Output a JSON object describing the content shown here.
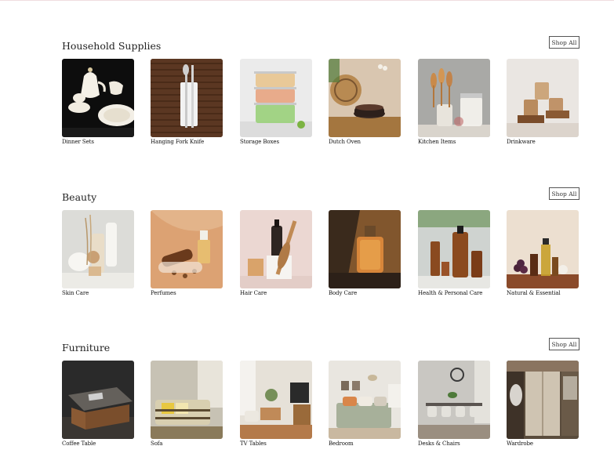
{
  "sections": [
    {
      "title": "Household Supplies",
      "shop_all": "Shop All",
      "items": [
        {
          "label": "Dinner Sets",
          "icon": "dinner-set-image"
        },
        {
          "label": "Hanging Fork Knife",
          "icon": "fork-knife-image"
        },
        {
          "label": "Storage Boxes",
          "icon": "storage-boxes-image"
        },
        {
          "label": "Dutch Oven",
          "icon": "dutch-oven-image"
        },
        {
          "label": "Kitchen Items",
          "icon": "kitchen-items-image"
        },
        {
          "label": "Drinkware",
          "icon": "drinkware-image"
        }
      ]
    },
    {
      "title": "Beauty",
      "shop_all": "Shop All",
      "items": [
        {
          "label": "Skin Care",
          "icon": "skin-care-image"
        },
        {
          "label": "Perfumes",
          "icon": "perfumes-image"
        },
        {
          "label": "Hair Care",
          "icon": "hair-care-image"
        },
        {
          "label": "Body Care",
          "icon": "body-care-image"
        },
        {
          "label": "Health & Personal Care",
          "icon": "health-personal-care-image"
        },
        {
          "label": "Natural & Essential",
          "icon": "natural-essential-image"
        }
      ]
    },
    {
      "title": "Furniture",
      "shop_all": "Shop All",
      "items": [
        {
          "label": "Coffee Table",
          "icon": "coffee-table-image"
        },
        {
          "label": "Sofa",
          "icon": "sofa-image"
        },
        {
          "label": "TV Tables",
          "icon": "tv-tables-image"
        },
        {
          "label": "Bedroom",
          "icon": "bedroom-image"
        },
        {
          "label": "Desks & Chairs",
          "icon": "desks-chairs-image"
        },
        {
          "label": "Wardrobe",
          "icon": "wardrobe-image"
        }
      ]
    }
  ]
}
